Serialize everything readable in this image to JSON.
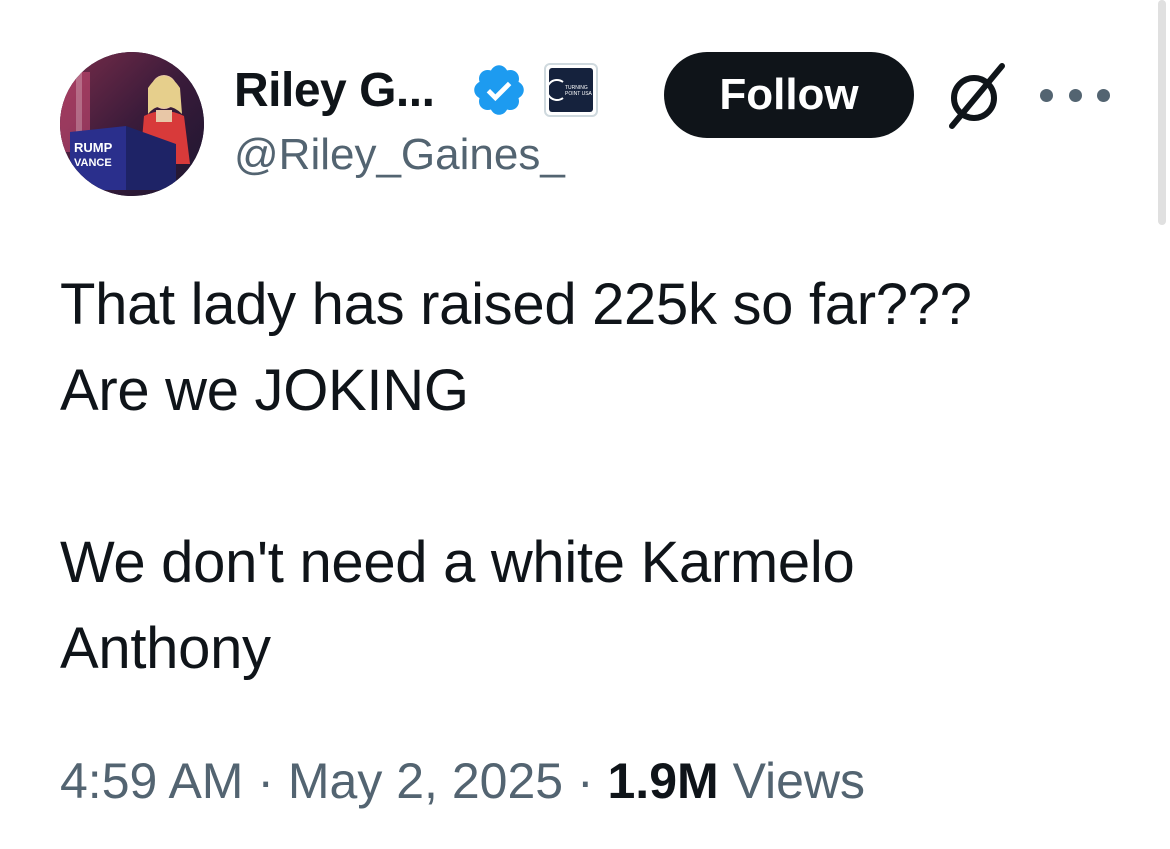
{
  "author": {
    "display_name": "Riley G...",
    "handle": "@Riley_Gaines_",
    "avatar_sign_text": "RUMP\nVANCE",
    "affiliation_badge": "TURNING POINT USA"
  },
  "header": {
    "follow_label": "Follow"
  },
  "tweet": {
    "text": "That lady has raised 225k so far???\nAre we JOKING\n\nWe don't need a white Karmelo\nAnthony"
  },
  "meta": {
    "time": "4:59 AM",
    "separator": " · ",
    "date": "May 2, 2025",
    "views_count": "1.9M",
    "views_label": " Views"
  },
  "icons": {
    "verified": "verified-badge-icon",
    "grok": "grok-icon",
    "more": "more-icon"
  },
  "colors": {
    "verified_blue": "#1d9bf0",
    "text": "#0f1419",
    "secondary": "#536471",
    "button_bg": "#0f1419",
    "badge_bg": "#15223d"
  }
}
